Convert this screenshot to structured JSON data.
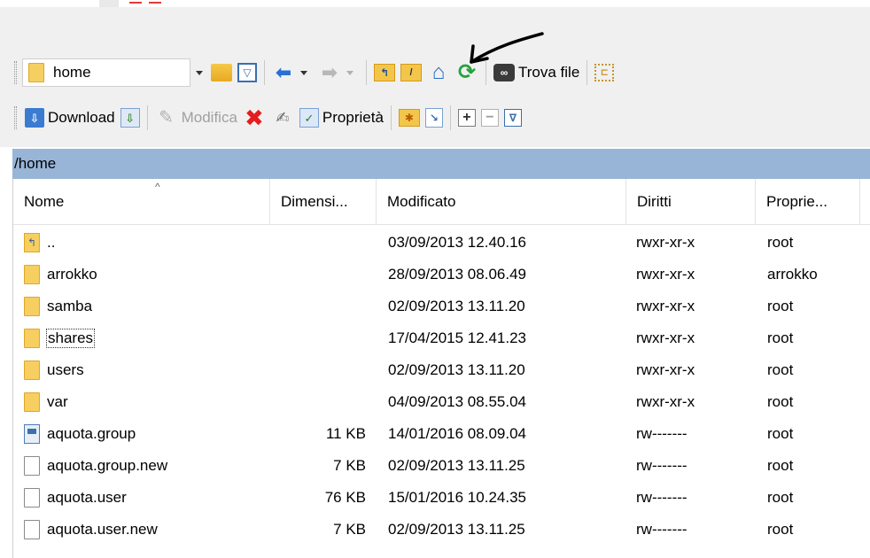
{
  "toolbar1": {
    "path_value": "home",
    "find_label": "Trova file"
  },
  "toolbar2": {
    "download_label": "Download",
    "edit_label": "Modifica",
    "properties_label": "Proprietà"
  },
  "current_path": "/home",
  "columns": [
    "Nome",
    "Dimensi...",
    "Modificato",
    "Diritti",
    "Proprie..."
  ],
  "rows": [
    {
      "name": "..",
      "size": "",
      "modified": "03/09/2013 12.40.16",
      "rights": "rwxr-xr-x",
      "owner": "root",
      "icon": "parent-folder-icon"
    },
    {
      "name": "arrokko",
      "size": "",
      "modified": "28/09/2013 08.06.49",
      "rights": "rwxr-xr-x",
      "owner": "arrokko",
      "icon": "folder-icon"
    },
    {
      "name": "samba",
      "size": "",
      "modified": "02/09/2013 13.11.20",
      "rights": "rwxr-xr-x",
      "owner": "root",
      "icon": "folder-icon"
    },
    {
      "name": "shares",
      "size": "",
      "modified": "17/04/2015 12.41.23",
      "rights": "rwxr-xr-x",
      "owner": "root",
      "icon": "folder-icon"
    },
    {
      "name": "users",
      "size": "",
      "modified": "02/09/2013 13.11.20",
      "rights": "rwxr-xr-x",
      "owner": "root",
      "icon": "folder-icon"
    },
    {
      "name": "var",
      "size": "",
      "modified": "04/09/2013 08.55.04",
      "rights": "rwxr-xr-x",
      "owner": "root",
      "icon": "folder-icon"
    },
    {
      "name": "aquota.group",
      "size": "11 KB",
      "modified": "14/01/2016 08.09.04",
      "rights": "rw-------",
      "owner": "root",
      "icon": "system-file-icon"
    },
    {
      "name": "aquota.group.new",
      "size": "7 KB",
      "modified": "02/09/2013 13.11.25",
      "rights": "rw-------",
      "owner": "root",
      "icon": "file-icon"
    },
    {
      "name": "aquota.user",
      "size": "76 KB",
      "modified": "15/01/2016 10.24.35",
      "rights": "rw-------",
      "owner": "root",
      "icon": "file-icon"
    },
    {
      "name": "aquota.user.new",
      "size": "7 KB",
      "modified": "02/09/2013 13.11.25",
      "rights": "rw-------",
      "owner": "root",
      "icon": "file-icon"
    }
  ]
}
